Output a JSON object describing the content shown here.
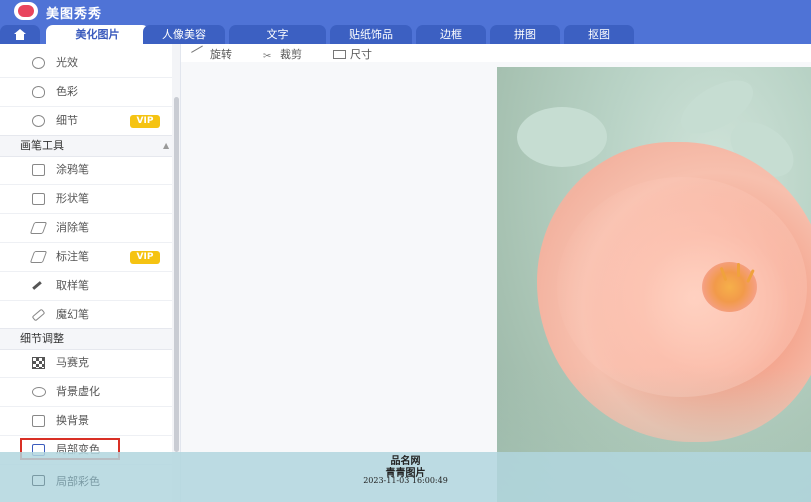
{
  "app": {
    "title": "美图秀秀"
  },
  "tabs": [
    {
      "label": "美化图片",
      "active": true
    },
    {
      "label": "人像美容"
    },
    {
      "label": "文字"
    },
    {
      "label": "贴纸饰品"
    },
    {
      "label": "边框"
    },
    {
      "label": "拼图"
    },
    {
      "label": "抠图"
    }
  ],
  "sidebar": {
    "items_top": [
      {
        "label": "光效",
        "icon": "sun-icon"
      },
      {
        "label": "色彩",
        "icon": "palette-icon"
      },
      {
        "label": "细节",
        "icon": "magnifier-icon",
        "badge": "VIP"
      }
    ],
    "sections": [
      {
        "title": "画笔工具",
        "items": [
          {
            "label": "涂鸦笔",
            "icon": "doodle-pen-icon"
          },
          {
            "label": "形状笔",
            "icon": "shape-pen-icon"
          },
          {
            "label": "消除笔",
            "icon": "eraser-pen-icon"
          },
          {
            "label": "标注笔",
            "icon": "marker-pen-icon",
            "badge": "VIP"
          },
          {
            "label": "取样笔",
            "icon": "eyedropper-icon"
          },
          {
            "label": "魔幻笔",
            "icon": "magic-pen-icon"
          }
        ]
      },
      {
        "title": "细节调整",
        "items": [
          {
            "label": "马赛克",
            "icon": "mosaic-icon"
          },
          {
            "label": "背景虚化",
            "icon": "blur-bg-icon"
          },
          {
            "label": "换背景",
            "icon": "replace-bg-icon"
          },
          {
            "label": "局部变色",
            "icon": "local-color-icon",
            "highlighted": true
          },
          {
            "label": "局部彩色",
            "icon": "local-colorful-icon"
          }
        ]
      }
    ]
  },
  "toolbar": {
    "rotate": "旋转",
    "crop": "裁剪",
    "size": "尺寸"
  },
  "watermark": {
    "line1": "品名网",
    "line2": "青青图片",
    "line3": "2023-11-03 16:00:49"
  },
  "colors": {
    "header": "#4f73d6",
    "accent": "#3b5bbd",
    "vip": "#f5c312",
    "highlight": "#d93025"
  }
}
